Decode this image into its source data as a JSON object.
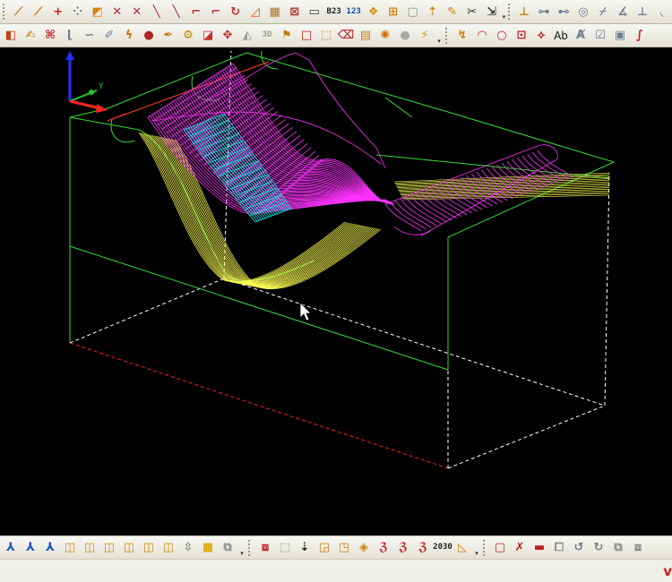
{
  "colors": {
    "viewport_bg": "#000000",
    "stock": "#33dd33",
    "hidden_edge": "#ffffff",
    "bottom_edge": "#ff2222",
    "surface_main": "#ff33ff",
    "surface_cyan": "#22e6e6",
    "toolpath": "#ffff55"
  },
  "toolbar_top": [
    {
      "name": "line-chain-icon",
      "glyph": "⟋",
      "color": "#d07010"
    },
    {
      "name": "polyline-icon",
      "glyph": "⟋",
      "color": "#d07010"
    },
    {
      "name": "point-plus-icon",
      "glyph": "+",
      "color": "#d02020"
    },
    {
      "name": "point-grid-icon",
      "glyph": "⁘",
      "color": "#777"
    },
    {
      "name": "box-arrow-icon",
      "glyph": "◩",
      "color": "#e08010"
    },
    {
      "name": "cross-line-icon",
      "glyph": "✕",
      "color": "#b03030"
    },
    {
      "name": "cross-line-2-icon",
      "glyph": "✕",
      "color": "#b03030"
    },
    {
      "name": "diagonal-line-icon",
      "glyph": "╲",
      "color": "#c02020"
    },
    {
      "name": "diagonal-line-2-icon",
      "glyph": "╲",
      "color": "#c02020"
    },
    {
      "name": "corner-arc-icon",
      "glyph": "⌐",
      "color": "#c03030"
    },
    {
      "name": "corner-arc-2-icon",
      "glyph": "⌐",
      "color": "#c03030"
    },
    {
      "name": "curve-arrow-icon",
      "glyph": "↻",
      "color": "#c03030"
    },
    {
      "name": "triangle-line-icon",
      "glyph": "◿",
      "color": "#d06010"
    },
    {
      "name": "grid-box-icon",
      "glyph": "▦",
      "color": "#b07020"
    },
    {
      "name": "grid-cross-icon",
      "glyph": "⊠",
      "color": "#b03030"
    },
    {
      "name": "rectangle-icon",
      "glyph": "▭",
      "color": "#333"
    },
    {
      "name": "numbering-icon",
      "glyph": "B23",
      "color": "#222",
      "text": true
    },
    {
      "name": "sequence-icon",
      "glyph": "123",
      "color": "#1050b0",
      "text": true
    },
    {
      "name": "shapes-icon",
      "glyph": "❖",
      "color": "#d09010"
    },
    {
      "name": "grid-square-icon",
      "glyph": "⊞",
      "color": "#d08010"
    },
    {
      "name": "frame-icon",
      "glyph": "▢",
      "color": "#888"
    },
    {
      "name": "arrow-up-box-icon",
      "glyph": "⇡",
      "color": "#d08010"
    },
    {
      "name": "pencil-edit-icon",
      "glyph": "✎",
      "color": "#d08010"
    },
    {
      "name": "scissors-icon",
      "glyph": "✂",
      "color": "#333"
    },
    {
      "name": "stretch-icon",
      "glyph": "⇲",
      "color": "#333"
    },
    {
      "name": "dimension-icon",
      "glyph": "⊥",
      "color": "#c08010"
    },
    {
      "name": "line-horizontal-icon",
      "glyph": "⊶",
      "color": "#708090"
    },
    {
      "name": "line-midpoint-icon",
      "glyph": "⊷",
      "color": "#708090"
    },
    {
      "name": "circle-center-icon",
      "glyph": "◎",
      "color": "#708090"
    },
    {
      "name": "tangent-icon",
      "glyph": "⌿",
      "color": "#708090"
    },
    {
      "name": "angle-icon",
      "glyph": "∡",
      "color": "#708090"
    },
    {
      "name": "perpendicular-icon",
      "glyph": "⊥",
      "color": "#708090"
    },
    {
      "name": "fillet-icon",
      "glyph": "◟",
      "color": "#708090"
    }
  ],
  "toolbar_second": [
    {
      "name": "solid-cube-icon",
      "glyph": "◧",
      "color": "#c04010"
    },
    {
      "name": "text-shape-icon",
      "glyph": "✍",
      "color": "#c08010"
    },
    {
      "name": "pattern-icon",
      "glyph": "⌘",
      "color": "#c03030"
    },
    {
      "name": "profile-icon",
      "glyph": "⌊",
      "color": "#708090"
    },
    {
      "name": "wave-icon",
      "glyph": "∽",
      "color": "#708090"
    },
    {
      "name": "edit-doc-icon",
      "glyph": "✐",
      "color": "#708090"
    },
    {
      "name": "lightning-icon",
      "glyph": "ϟ",
      "color": "#d07010"
    },
    {
      "name": "sphere-icon",
      "glyph": "●",
      "color": "#b02020"
    },
    {
      "name": "pen-draw-icon",
      "glyph": "✒",
      "color": "#c08010"
    },
    {
      "name": "gear-box-icon",
      "glyph": "⚙",
      "color": "#c08010"
    },
    {
      "name": "boot-icon",
      "glyph": "◪",
      "color": "#c03030"
    },
    {
      "name": "move-icon",
      "glyph": "✥",
      "color": "#c03030"
    },
    {
      "name": "solid-gray-icon",
      "glyph": "◭",
      "color": "#999"
    },
    {
      "name": "view-3d-icon",
      "glyph": "3D",
      "color": "#999",
      "text": true
    },
    {
      "name": "surface-flag-icon",
      "glyph": "⚑",
      "color": "#c08010"
    },
    {
      "name": "square-outline-icon",
      "glyph": "□",
      "color": "#c02020"
    },
    {
      "name": "extrude-icon",
      "glyph": "⬚",
      "color": "#c08010"
    },
    {
      "name": "eraser-icon",
      "glyph": "⌫",
      "color": "#c03030"
    },
    {
      "name": "layer-icon",
      "glyph": "▤",
      "color": "#c08010"
    },
    {
      "name": "sparkle-icon",
      "glyph": "✺",
      "color": "#d07010"
    },
    {
      "name": "dot-gray-icon",
      "glyph": "●",
      "color": "#aaa"
    },
    {
      "name": "wand-icon",
      "glyph": "⚡",
      "color": "#d0a010"
    }
  ],
  "toolbar_second_right": [
    {
      "name": "curve-point-icon",
      "glyph": "↯",
      "color": "#d08010"
    },
    {
      "name": "arc-icon",
      "glyph": "◠",
      "color": "#c02020"
    },
    {
      "name": "circle-icon",
      "glyph": "○",
      "color": "#c02020"
    },
    {
      "name": "rectangle-select-icon",
      "glyph": "⊡",
      "color": "#c02020"
    },
    {
      "name": "node-edit-icon",
      "glyph": "⟡",
      "color": "#c02020"
    },
    {
      "name": "text-ab-icon",
      "glyph": "Ab",
      "color": "#111",
      "textb": true
    },
    {
      "name": "dimension-text-icon",
      "glyph": "Ⱥ",
      "color": "#708090"
    },
    {
      "name": "checklist-icon",
      "glyph": "☑",
      "color": "#708090"
    },
    {
      "name": "calc-icon",
      "glyph": "▣",
      "color": "#708090"
    },
    {
      "name": "s-curve-icon",
      "glyph": "∫",
      "color": "#c02020"
    }
  ],
  "toolbar_bottom": [
    {
      "name": "axis-xyz-icon",
      "glyph": "⅄",
      "color": "#2050c0"
    },
    {
      "name": "axis-xyz-2-icon",
      "glyph": "⅄",
      "color": "#2050c0"
    },
    {
      "name": "axis-xyz-3-icon",
      "glyph": "⅄",
      "color": "#2050c0"
    },
    {
      "name": "view-front-icon",
      "glyph": "◫",
      "color": "#d09010"
    },
    {
      "name": "view-back-icon",
      "glyph": "◫",
      "color": "#d09010"
    },
    {
      "name": "view-left-icon",
      "glyph": "◫",
      "color": "#d09010"
    },
    {
      "name": "view-right-icon",
      "glyph": "◫",
      "color": "#d09010"
    },
    {
      "name": "view-top-icon",
      "glyph": "◫",
      "color": "#d09010"
    },
    {
      "name": "view-bottom-icon",
      "glyph": "◫",
      "color": "#d09010"
    },
    {
      "name": "view-iso-icon",
      "glyph": "⇳",
      "color": "#888"
    },
    {
      "name": "view-square-icon",
      "glyph": "■",
      "color": "#e0b020"
    },
    {
      "name": "view-wire-icon",
      "glyph": "⧉",
      "color": "#888"
    }
  ],
  "toolbar_bottom_mid": [
    {
      "name": "machining-box-icon",
      "glyph": "⧈",
      "color": "#c02020"
    },
    {
      "name": "stock-box-icon",
      "glyph": "⬚",
      "color": "#888"
    },
    {
      "name": "drill-icon",
      "glyph": "⇣",
      "color": "#222"
    },
    {
      "name": "pocket-icon",
      "glyph": "◲",
      "color": "#d08010"
    },
    {
      "name": "contour-icon",
      "glyph": "◳",
      "color": "#d08010"
    },
    {
      "name": "facing-icon",
      "glyph": "◈",
      "color": "#d08010"
    },
    {
      "name": "toolpath-z-icon",
      "glyph": "ℨ",
      "color": "#c02020"
    },
    {
      "name": "toolpath-z2-icon",
      "glyph": "ℨ",
      "color": "#c02020"
    },
    {
      "name": "toolpath-z3-icon",
      "glyph": "ℨ",
      "color": "#c02020"
    },
    {
      "name": "counter-2030-icon",
      "glyph": "2030",
      "color": "#222",
      "text": true
    },
    {
      "name": "surface-finish-icon",
      "glyph": "◺",
      "color": "#d08010"
    }
  ],
  "toolbar_bottom_right": [
    {
      "name": "solid-red-icon",
      "glyph": "▢",
      "color": "#c02020"
    },
    {
      "name": "delete-shape-icon",
      "glyph": "✗",
      "color": "#c02020"
    },
    {
      "name": "video-icon",
      "glyph": "▬",
      "color": "#c02020"
    },
    {
      "name": "copy-icon",
      "glyph": "⧠",
      "color": "#888"
    },
    {
      "name": "rotate-icon",
      "glyph": "↺",
      "color": "#708090"
    },
    {
      "name": "rotate-2-icon",
      "glyph": "↻",
      "color": "#708090"
    },
    {
      "name": "layers-icon",
      "glyph": "⧉",
      "color": "#888"
    },
    {
      "name": "window-icon",
      "glyph": "⧈",
      "color": "#888"
    }
  ],
  "axes": {
    "y_label": "Y"
  },
  "status": {
    "right_mark": "v"
  }
}
